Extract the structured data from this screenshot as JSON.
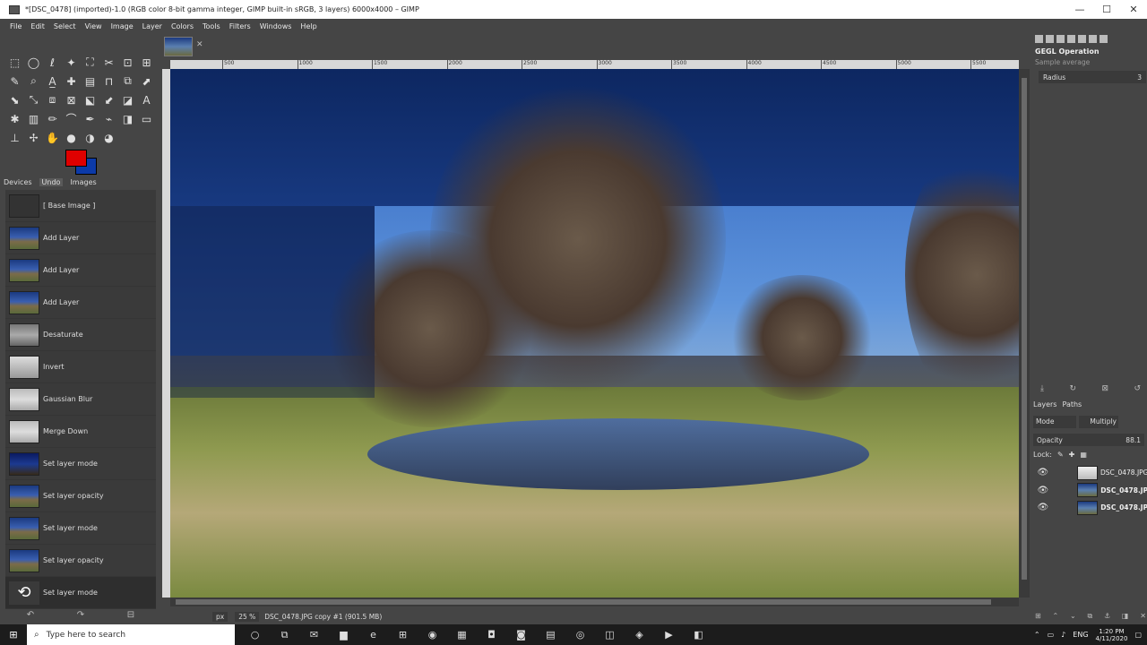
{
  "window": {
    "title": "*[DSC_0478] (imported)-1.0 (RGB color 8-bit gamma integer, GIMP built-in sRGB, 3 layers) 6000x4000 – GIMP",
    "minimize": "—",
    "maximize": "☐",
    "close": "✕"
  },
  "menu": [
    "File",
    "Edit",
    "Select",
    "View",
    "Image",
    "Layer",
    "Colors",
    "Tools",
    "Filters",
    "Windows",
    "Help"
  ],
  "toolbox": {
    "tool_icons": [
      "⬚",
      "◯",
      "ℓ",
      "✦",
      "⛶",
      "✂",
      "⊡",
      "⊞",
      "✎",
      "⌕",
      "A̲",
      "✚",
      "▤",
      "⊓",
      "⧉",
      "⬈",
      "⬊",
      "⤡",
      "⧈",
      "⊠",
      "⬕",
      "⬋",
      "◪",
      "A",
      "✱",
      "▥",
      "✏",
      "⌒",
      "✒",
      "⌁",
      "◨",
      "▭",
      "⊥",
      "✢",
      "✋",
      "●",
      "◑",
      "◕"
    ],
    "colors": {
      "foreground": "#e00000",
      "background": "#0c3aa8"
    }
  },
  "dock_tabs": {
    "devices": "Devices",
    "undo": "Undo",
    "images": "Images"
  },
  "undo_history": [
    {
      "label": "[ Base Image ]",
      "thumb": "blank"
    },
    {
      "label": "Add Layer",
      "thumb": "color"
    },
    {
      "label": "Add Layer",
      "thumb": "color"
    },
    {
      "label": "Add Layer",
      "thumb": "color"
    },
    {
      "label": "Desaturate",
      "thumb": "gray"
    },
    {
      "label": "Invert",
      "thumb": "invert"
    },
    {
      "label": "Gaussian Blur",
      "thumb": "blur"
    },
    {
      "label": "Merge Down",
      "thumb": "blur"
    },
    {
      "label": "Set layer mode",
      "thumb": "dark"
    },
    {
      "label": "Set layer opacity",
      "thumb": "color"
    },
    {
      "label": "Set layer mode",
      "thumb": "color"
    },
    {
      "label": "Set layer opacity",
      "thumb": "color"
    },
    {
      "label": "Set layer mode",
      "thumb": "undo"
    }
  ],
  "toolbox_bottom": {
    "undo": "↶",
    "redo": "↷",
    "clear": "⊟"
  },
  "ruler": {
    "ticks": [
      "500",
      "1000",
      "1500",
      "2000",
      "2500",
      "3000",
      "3500",
      "4000",
      "4500",
      "5000",
      "5500"
    ]
  },
  "status": {
    "unit": "px",
    "zoom": "25 %",
    "info": "DSC_0478.JPG copy #1 (901.5 MB)"
  },
  "gegl": {
    "title": "GEGL Operation",
    "operation": "Sample average",
    "radius_label": "Radius",
    "radius_value": "3"
  },
  "layers_panel": {
    "tab_layers": "Layers",
    "tab_paths": "Paths",
    "mode_label": "Mode",
    "mode_value": "Multiply",
    "opacity_label": "Opacity",
    "opacity_value": "88.1",
    "lock_label": "Lock:",
    "layers": [
      {
        "name": "DSC_0478.JPG",
        "thumb": "white",
        "selected": true
      },
      {
        "name": "DSC_0478.JP",
        "thumb": "color",
        "selected": false
      },
      {
        "name": "DSC_0478.JP",
        "thumb": "color",
        "selected": false
      }
    ]
  },
  "taskbar": {
    "search_placeholder": "Type here to search",
    "apps": [
      "○",
      "⧉",
      "✉",
      "▆",
      "e",
      "⊞",
      "◉",
      "▦",
      "◘",
      "◙",
      "▤",
      "◎",
      "◫",
      "◈",
      "▶",
      "◧"
    ],
    "lang": "ENG",
    "time": "1:20 PM",
    "date": "4/11/2020"
  }
}
